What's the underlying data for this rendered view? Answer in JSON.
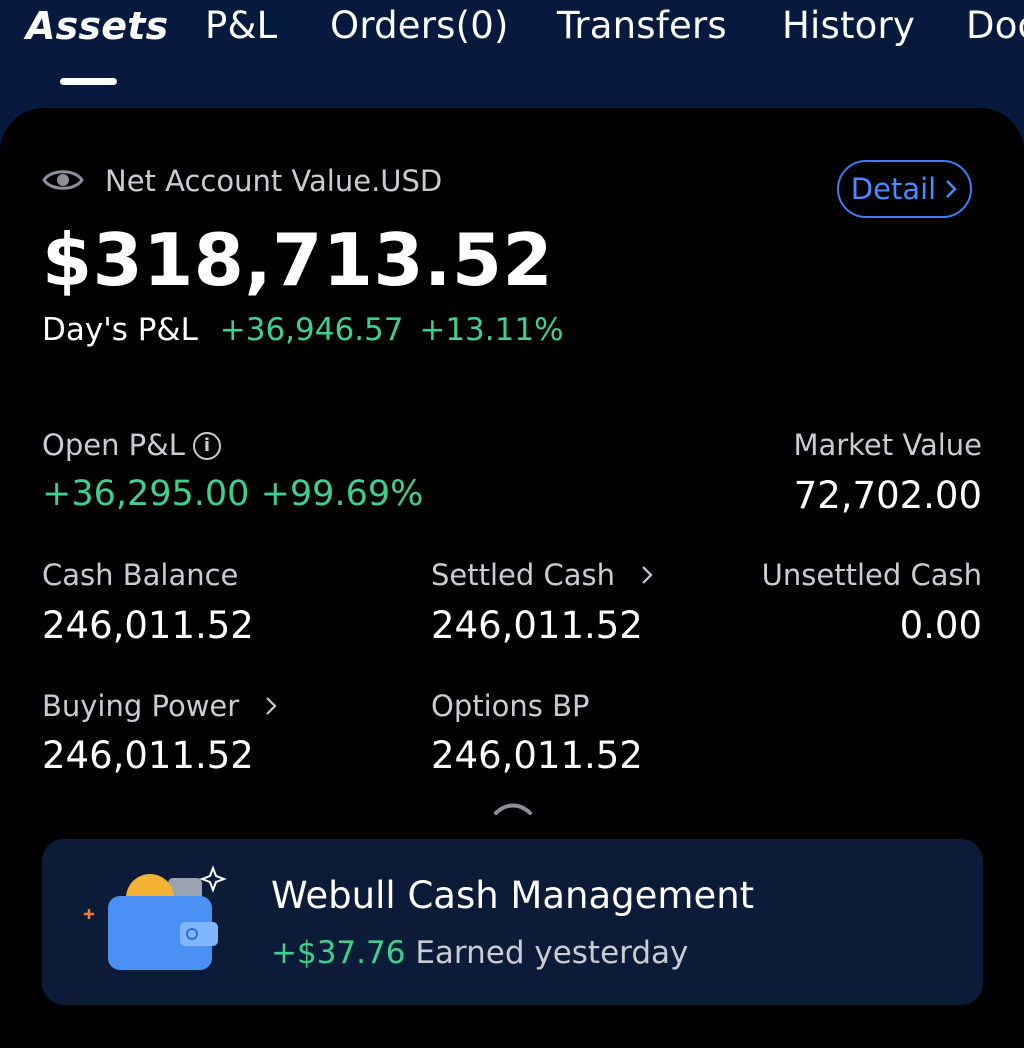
{
  "nav": {
    "tabs": [
      {
        "label": "Assets"
      },
      {
        "label": "P&L"
      },
      {
        "label": "Orders(0)"
      },
      {
        "label": "Transfers"
      },
      {
        "label": "History"
      },
      {
        "label": "Doc"
      }
    ]
  },
  "account": {
    "net_label": "Net Account Value.USD",
    "detail_label": "Detail",
    "net_value": "$318,713.52",
    "days_pl_label": "Day's P&L",
    "days_pl_amount": "+36,946.57",
    "days_pl_pct": "+13.11%"
  },
  "metrics": {
    "open_pl_label": "Open P&L",
    "open_pl_info": "i",
    "open_pl_value": "+36,295.00 +99.69%",
    "market_value_label": "Market Value",
    "market_value": "72,702.00",
    "cash_balance_label": "Cash Balance",
    "cash_balance": "246,011.52",
    "settled_cash_label": "Settled Cash",
    "settled_cash": "246,011.52",
    "unsettled_cash_label": "Unsettled Cash",
    "unsettled_cash": "0.00",
    "buying_power_label": "Buying Power",
    "buying_power": "246,011.52",
    "options_bp_label": "Options BP",
    "options_bp": "246,011.52"
  },
  "promo": {
    "title": "Webull Cash Management",
    "earned_amount": "+$37.76",
    "earned_text": "Earned yesterday"
  },
  "icons": {
    "eye": "eye-icon",
    "chevron": "chevron-right-icon",
    "info": "info-icon",
    "collapse": "chevron-up-icon",
    "wallet": "wallet-icon"
  },
  "colors": {
    "nav_bg": "#071a3e",
    "panel_bg": "#000000",
    "positive": "#3fcf8e",
    "accent": "#3d7cf5",
    "card_bg": "#0c1c38"
  }
}
